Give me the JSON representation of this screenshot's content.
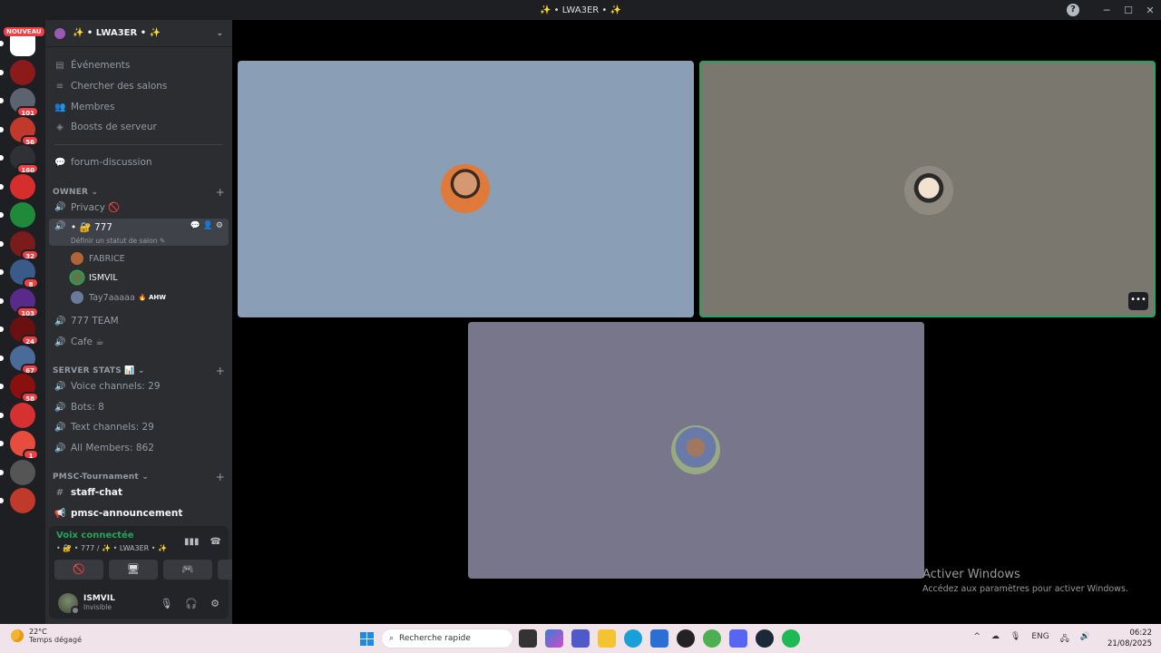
{
  "window": {
    "title": "✨ • LWA3ER • ✨",
    "help_glyph": "?"
  },
  "server_rail": {
    "new_label": "NOUVEAU",
    "servers": [
      {
        "name": "server-1",
        "color": "#ffffff"
      },
      {
        "name": "server-2",
        "color": "#8b1a1a",
        "badge": ""
      },
      {
        "name": "server-3",
        "color": "#5b6270",
        "badge": "101"
      },
      {
        "name": "server-4",
        "color": "#c0392b",
        "badge": "56"
      },
      {
        "name": "server-5",
        "color": "#2f3136",
        "badge": "160"
      },
      {
        "name": "server-6",
        "color": "#d62d2d",
        "badge": ""
      },
      {
        "name": "server-7",
        "color": "#1f8a3a",
        "badge": ""
      },
      {
        "name": "server-8",
        "color": "#7a1c1c",
        "badge": "32"
      },
      {
        "name": "server-9",
        "color": "#3a5a8a",
        "badge": "8"
      },
      {
        "name": "server-10",
        "color": "#5a2a8a",
        "badge": "103"
      },
      {
        "name": "server-11",
        "color": "#6b1010",
        "badge": "24"
      },
      {
        "name": "server-12",
        "color": "#4a6a9a",
        "badge": "67"
      },
      {
        "name": "server-13",
        "color": "#8a1010",
        "badge": "58"
      },
      {
        "name": "server-14",
        "color": "#d63031",
        "badge": ""
      },
      {
        "name": "server-15",
        "color": "#e74c3c",
        "badge": "1"
      },
      {
        "name": "server-16",
        "color": "#555555",
        "badge": ""
      },
      {
        "name": "server-17",
        "color": "#c0392b",
        "badge": ""
      }
    ]
  },
  "sidebar": {
    "guild_name": "✨ • LWA3ER • ✨",
    "menu": {
      "events": "Événements",
      "browse": "Chercher des salons",
      "members": "Membres",
      "boosts": "Boosts de serveur"
    },
    "forum": "forum-discussion",
    "cat_owner": "OWNER",
    "privacy": "Privacy 🚫",
    "voice_777": "• 🔐 777",
    "voice_777_status": "Définir un statut de salon ✎",
    "voice_members": [
      {
        "name": "FABRICE",
        "tag": ""
      },
      {
        "name": "ISMVIL",
        "tag": ""
      },
      {
        "name": "Tay7aaaaa",
        "tag": "AHW"
      }
    ],
    "team": "777 TEAM",
    "cafe": "Cafe ☕",
    "cat_stats": "SERVER STATS 📊",
    "stats": {
      "voice": "Voice channels: 29",
      "bots": "Bots: 8",
      "text": "Text channels: 29",
      "members": "All Members: 862"
    },
    "cat_pmsc": "PMSC-Tournament",
    "staff_chat": "staff-chat",
    "pmsc_announcement": "pmsc-announcement"
  },
  "voice_panel": {
    "status": "Voix connectée",
    "location": "• 🔐 • 777 / ✨ • LWA3ER • ✨",
    "user_name": "ISMVIL",
    "user_status": "Invisible"
  },
  "stage": {
    "tiles": [
      {
        "name": "tile-1",
        "color": "#8a9fb6"
      },
      {
        "name": "tile-2",
        "color": "#7a776f"
      },
      {
        "name": "tile-3",
        "color": "#77768a"
      }
    ],
    "more_label": "•••",
    "watermark_title": "Activer Windows",
    "watermark_sub": "Accédez aux paramètres pour activer Windows."
  },
  "taskbar": {
    "temp": "22°C",
    "weather": "Temps dégagé",
    "search_placeholder": "Recherche rapide",
    "lang": "ENG",
    "time": "06:22",
    "date": "21/08/2025"
  }
}
